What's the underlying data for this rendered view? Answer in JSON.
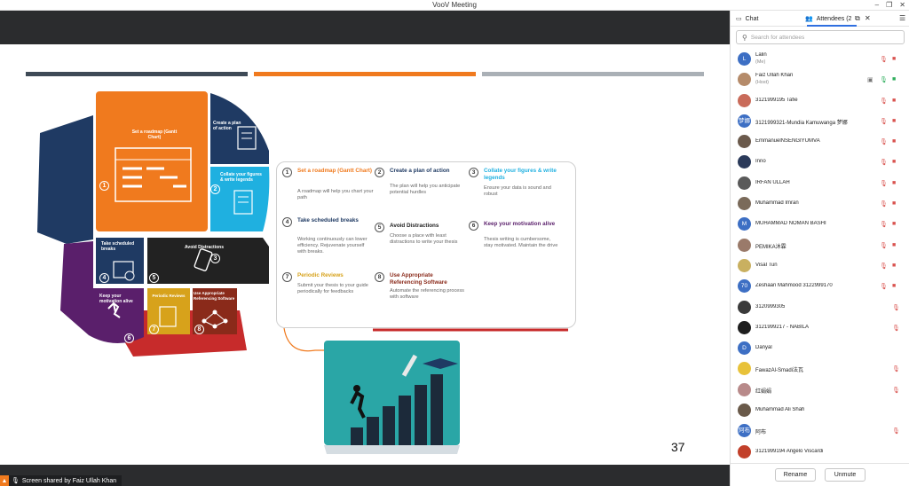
{
  "app": {
    "title": "VooV Meeting"
  },
  "window_controls": {
    "minimize": "–",
    "restore": "❐",
    "close": "✕"
  },
  "share": {
    "label": "Screen shared by Faiz Ullah Khan",
    "slide": {
      "number": "37",
      "head_segments": [
        {
          "num": "1",
          "text": "Set a roadmap (Gantt Chart)"
        },
        {
          "num": "2",
          "text": "Create a plan of action"
        },
        {
          "num": "3",
          "text": "Collate your figures & write legends"
        },
        {
          "num": "4",
          "text": "Take scheduled breaks"
        },
        {
          "num": "5",
          "text": "Avoid Distractions"
        },
        {
          "num": "6",
          "text": "Keep your motivation alive"
        },
        {
          "num": "7",
          "text": "Periodic Reviews"
        },
        {
          "num": "8",
          "text": "Use Appropriate Referencing Software"
        }
      ],
      "steps": [
        {
          "num": "1",
          "title": "Set a roadmap (Gantt Chart)",
          "desc": "A roadmap will help you chart your path",
          "color": "#f07a1e"
        },
        {
          "num": "2",
          "title": "Create a plan of action",
          "desc": "The plan will help you anticipate potential hurdles",
          "color": "#1f3a63"
        },
        {
          "num": "3",
          "title": "Collate your figures & write legends",
          "desc": "Ensure your data is sound and robust",
          "color": "#1fb0e0"
        },
        {
          "num": "4",
          "title": "Take scheduled breaks",
          "desc": "Working continuously can lower efficiency. Rejuvenate yourself with breaks.",
          "color": "#1f3a63"
        },
        {
          "num": "5",
          "title": "Avoid Distractions",
          "desc": "Choose a place with least distractions to write your thesis",
          "color": "#222222"
        },
        {
          "num": "6",
          "title": "Keep your motivation alive",
          "desc": "Thesis writing is cumbersome, stay motivated. Maintain the drive",
          "color": "#5a1f6b"
        },
        {
          "num": "7",
          "title": "Periodic Reviews",
          "desc": "Submit your thesis to your guide periodically for feedbacks",
          "color": "#d7a21b"
        },
        {
          "num": "8",
          "title": "Use Appropriate Referencing Software",
          "desc": "Automate the referencing process with software",
          "color": "#8a2a1a"
        }
      ]
    }
  },
  "sidebar": {
    "tabs": {
      "chat": "Chat",
      "attendees": "Attendees (2"
    },
    "search_placeholder": "Search for attendees",
    "attendees": [
      {
        "name": "Lalin",
        "role": "(Me)",
        "avatar": "L",
        "avatar_color": "#3d6fc4",
        "mic": "muted",
        "cam": "off"
      },
      {
        "name": "Faiz Ullah Khan",
        "role": "(Host)",
        "avatar": "",
        "avatar_color": "#b58b6a",
        "mic": "on",
        "cam": "on",
        "sharing": true
      },
      {
        "name": "3121999195 Tafie",
        "avatar": "",
        "avatar_color": "#c96b5a",
        "mic": "muted",
        "cam": "off"
      },
      {
        "name": "3121999321-Mundia Kamuwanga 梦娜",
        "avatar": "梦娜",
        "avatar_color": "#3d6fc4",
        "mic": "muted",
        "cam": "off"
      },
      {
        "name": "EmmanuelNSENGIYUMVA",
        "avatar": "",
        "avatar_color": "#6b5a4c",
        "mic": "muted",
        "cam": "off"
      },
      {
        "name": "Inno",
        "avatar": "",
        "avatar_color": "#2b3a5a",
        "mic": "muted",
        "cam": "off"
      },
      {
        "name": "IRFAN ULLAH",
        "avatar": "",
        "avatar_color": "#5a5a5a",
        "mic": "muted",
        "cam": "off"
      },
      {
        "name": "Muhammad Imran",
        "avatar": "",
        "avatar_color": "#7a6a5a",
        "mic": "muted",
        "cam": "off"
      },
      {
        "name": "MUHAMMAD NOMAN BASHI",
        "avatar": "M",
        "avatar_color": "#3d6fc4",
        "mic": "muted",
        "cam": "off"
      },
      {
        "name": "PEMIKA沐霖",
        "avatar": "",
        "avatar_color": "#9a7a6a",
        "mic": "muted",
        "cam": "off"
      },
      {
        "name": "Visal Tun",
        "avatar": "",
        "avatar_color": "#c9b060",
        "mic": "muted",
        "cam": "off"
      },
      {
        "name": "Zeshaan Mahmood 3122999170",
        "avatar": "70",
        "avatar_color": "#3d6fc4",
        "mic": "muted",
        "cam": "off"
      },
      {
        "name": "3120999305",
        "avatar": "",
        "avatar_color": "#3a3a3a",
        "mic": "muted"
      },
      {
        "name": "3121999217 - NABILA",
        "avatar": "",
        "avatar_color": "#1e1e1e",
        "mic": "muted"
      },
      {
        "name": "Danyal",
        "avatar": "D",
        "avatar_color": "#3d6fc4"
      },
      {
        "name": "FawazAl-Smadi法瓦",
        "avatar": "",
        "avatar_color": "#e8c23a",
        "mic": "muted"
      },
      {
        "name": "红娟娟",
        "avatar": "",
        "avatar_color": "#b88a8a",
        "mic": "muted"
      },
      {
        "name": "Muhammad Ali Shah",
        "avatar": "",
        "avatar_color": "#6a5a4a"
      },
      {
        "name": "阿布",
        "avatar": "阿布",
        "avatar_color": "#3d6fc4",
        "mic": "muted"
      },
      {
        "name": "3121999194 Angelo Viscardi",
        "avatar": "",
        "avatar_color": "#c2402a"
      }
    ],
    "buttons": {
      "rename": "Rename",
      "unmute": "Unmute"
    }
  }
}
